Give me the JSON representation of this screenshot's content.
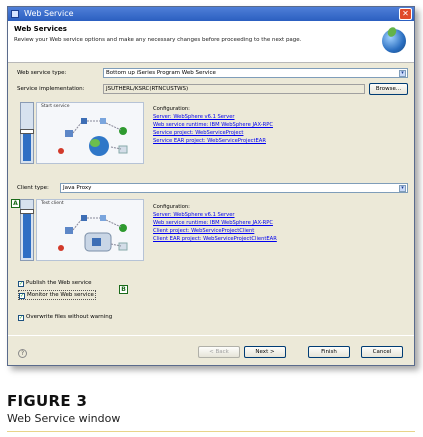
{
  "window": {
    "title": "Web Service"
  },
  "header": {
    "title": "Web Services",
    "subtitle": "Review your Web service options and make any necessary changes before proceeding to the next page."
  },
  "service": {
    "type_label": "Web service type:",
    "type_value": "Bottom up iSeries Program Web Service",
    "impl_label": "Service implementation:",
    "impl_value": "JSUTHERL/KSRC(RTNCUSTWS)",
    "browse_label": "Browse...",
    "slider_caption": "Start service",
    "slider_level": 0.55,
    "config_heading": "Configuration:",
    "links": [
      "Server: WebSphere v6.1 Server",
      "Web service runtime: IBM WebSphere JAX-RPC",
      "Service project: WebServiceProject",
      "Service EAR project: WebServiceProjectEAR"
    ]
  },
  "client": {
    "type_label": "Client type:",
    "type_value": "Java Proxy",
    "slider_caption": "Test client",
    "slider_level": 0.85,
    "marker_a": "A",
    "config_heading": "Configuration:",
    "links": [
      "Server: WebSphere v6.1 Server",
      "Web service runtime: IBM WebSphere JAX-RPC",
      "Client project: WebServiceProjectClient",
      "Client EAR project: WebServiceProjectClientEAR"
    ]
  },
  "options": {
    "publish": "Publish the Web service",
    "monitor": "Monitor the Web service",
    "marker_b": "B",
    "overwrite": "Overwrite files without warning"
  },
  "buttons": {
    "back": "< Back",
    "next": "Next >",
    "finish": "Finish",
    "cancel": "Cancel"
  },
  "figure": {
    "label": "FIGURE 3",
    "caption": "Web Service window"
  }
}
